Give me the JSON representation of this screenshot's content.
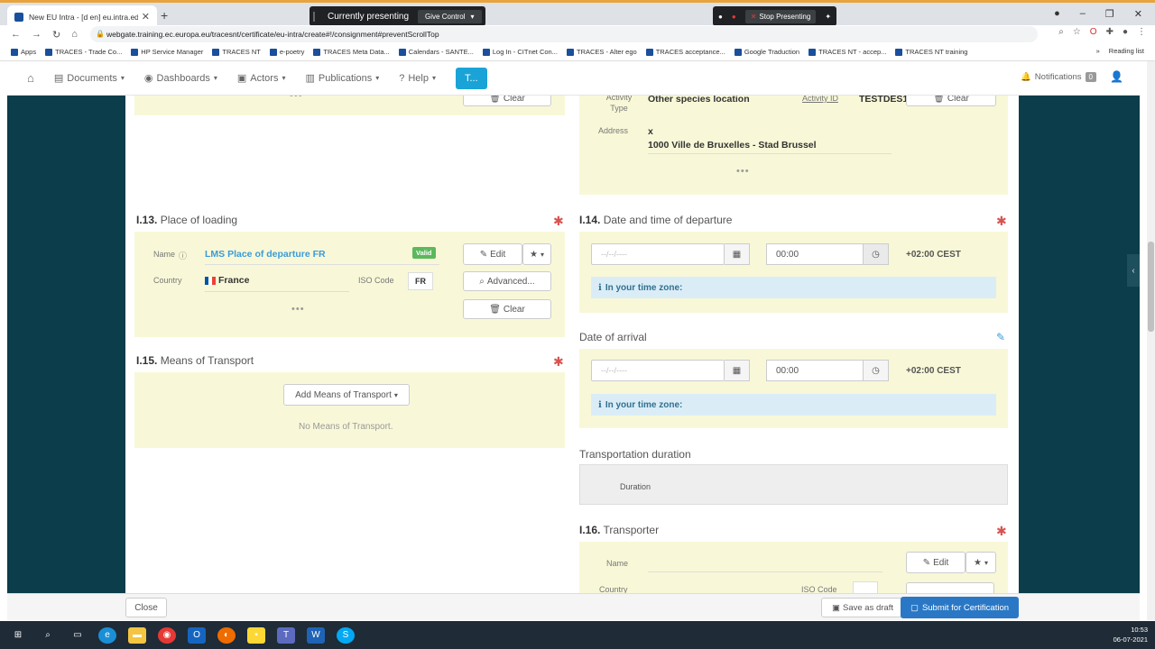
{
  "browser": {
    "tab_title": "New EU Intra - [d en] eu.intra.ed",
    "presenting": "Currently presenting",
    "give_control": "Give Control",
    "stop_presenting": "Stop Presenting",
    "url": "webgate.training.ec.europa.eu/tracesnt/certificate/eu-intra/create#!/consignment#preventScrollTop",
    "bookmarks": [
      "Apps",
      "TRACES - Trade Co...",
      "HP Service Manager",
      "TRACES NT",
      "e-poetry",
      "TRACES Meta Data...",
      "Calendars - SANTE...",
      "Log In - CITnet Con...",
      "TRACES - Alter ego",
      "TRACES acceptance...",
      "Google Traduction",
      "TRACES NT - accep...",
      "TRACES NT training"
    ],
    "reading_list": "Reading list"
  },
  "nav": {
    "documents": "Documents",
    "dashboards": "Dashboards",
    "actors": "Actors",
    "publications": "Publications",
    "help": "Help",
    "t_button": "T...",
    "notifications": "Notifications",
    "notif_count": "0"
  },
  "top_left": {
    "clear": "Clear"
  },
  "top_right": {
    "activity_type_label": "Activity Type",
    "activity_type": "Other species location",
    "activity_id_label": "Activity ID",
    "activity_id": "TESTDES1",
    "clear": "Clear",
    "address_label": "Address",
    "address_line1": "x",
    "address_line2": "1000 Ville de Bruxelles - Stad Brussel"
  },
  "loading": {
    "number": "I.13.",
    "title": "Place of loading",
    "name_label": "Name",
    "name": "LMS Place of departure FR",
    "valid": "Valid",
    "edit": "Edit",
    "country_label": "Country",
    "country": "France",
    "iso_label": "ISO Code",
    "iso": "FR",
    "advanced": "Advanced...",
    "clear": "Clear"
  },
  "transport": {
    "number": "I.15.",
    "title": "Means of Transport",
    "add": "Add Means of Transport",
    "empty": "No Means of Transport."
  },
  "departure": {
    "number": "I.14.",
    "title": "Date and time of departure",
    "date_placeholder": "--/--/----",
    "time": "00:00",
    "tz": "+02:00 CEST",
    "info": "In your time zone:"
  },
  "arrival": {
    "title": "Date of arrival",
    "date_placeholder": "--/--/----",
    "time": "00:00",
    "tz": "+02:00 CEST",
    "info": "In your time zone:"
  },
  "duration": {
    "title": "Transportation duration",
    "label": "Duration"
  },
  "transporter": {
    "number": "I.16.",
    "title": "Transporter",
    "name_label": "Name",
    "edit": "Edit",
    "country_label": "Country",
    "iso_label": "ISO Code"
  },
  "actions": {
    "close": "Close",
    "save_draft": "Save as draft",
    "submit": "Submit for Certification"
  },
  "clock": {
    "time": "10:53",
    "date": "06-07-2021"
  },
  "colors": {
    "panel": "#f8f8d8",
    "sidebar": "#0b3d4a",
    "primary": "#2a78c5",
    "link": "#3a9bd9",
    "valid": "#5cb85c",
    "required": "#d9534f"
  }
}
